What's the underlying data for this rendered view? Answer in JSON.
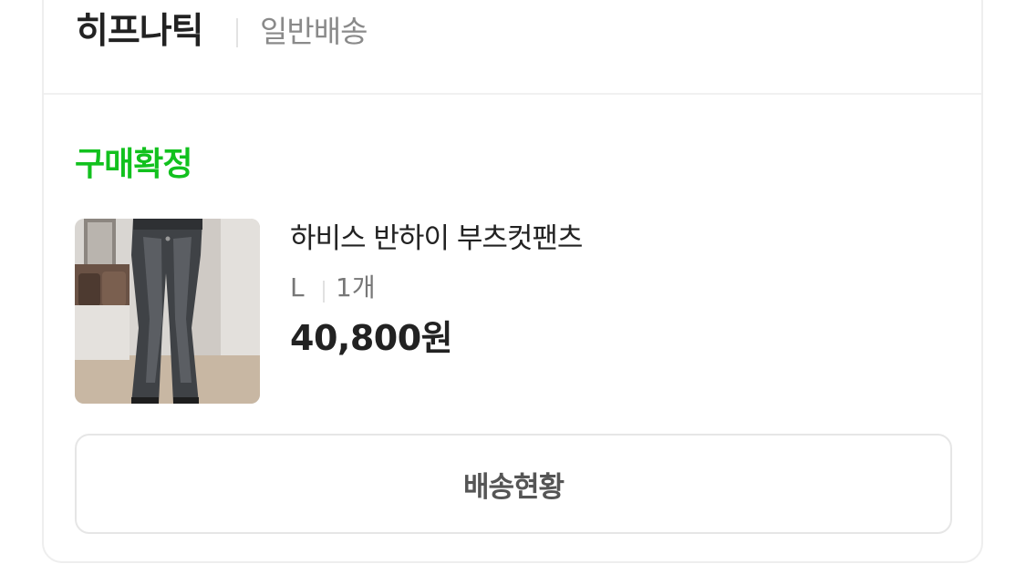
{
  "order_card": {
    "shop_name": "히프나틱",
    "shipping_type": "일반배송",
    "status": "구매확정",
    "status_color": "#12c11e",
    "product": {
      "title": "하비스 반하이 부츠컷팬츠",
      "option_size": "L",
      "option_quantity": "1개",
      "price": "40,800원",
      "thumbnail_icon": "jeans-photo"
    },
    "track_button_label": "배송현황"
  }
}
